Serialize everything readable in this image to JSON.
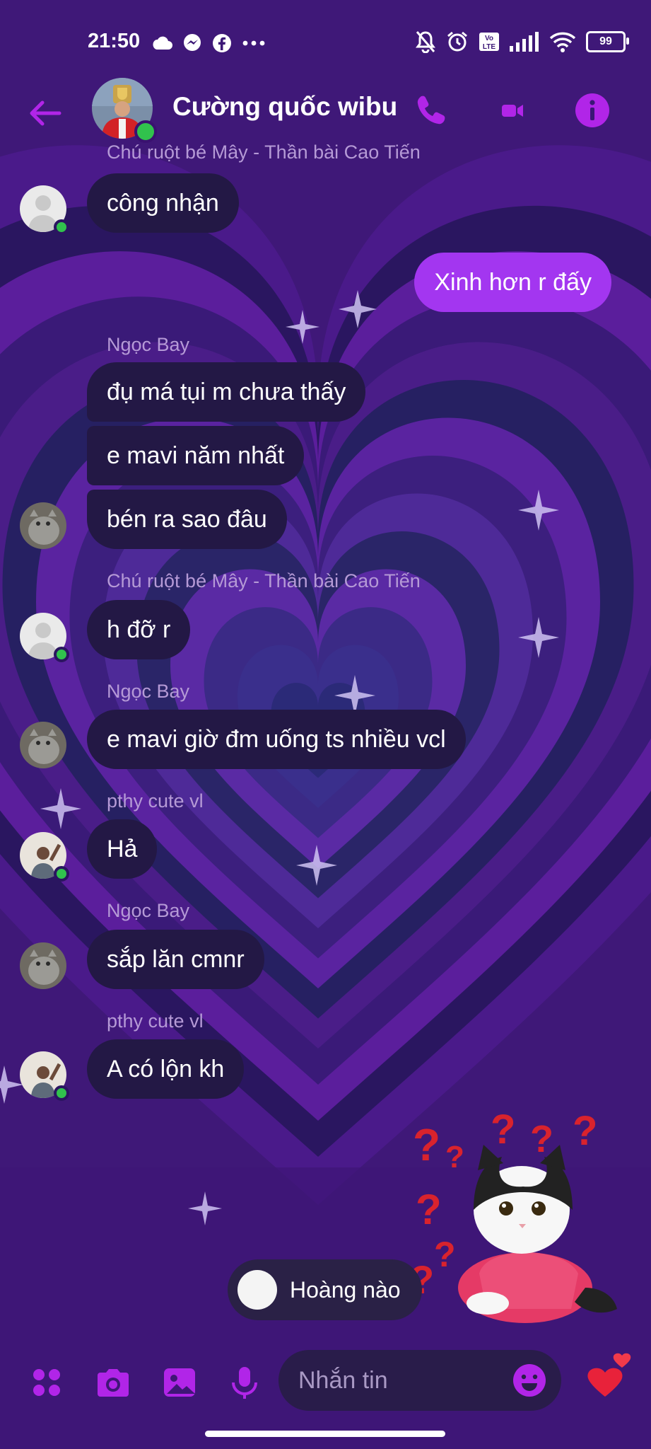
{
  "status_bar": {
    "time": "21:50",
    "battery": "99",
    "left_icons": [
      "cloud-icon",
      "messenger-icon",
      "facebook-icon",
      "more-dots-icon"
    ],
    "right_icons": [
      "mute-bell-icon",
      "alarm-icon",
      "volte-icon",
      "signal-icon",
      "wifi-icon",
      "battery-icon"
    ]
  },
  "header": {
    "title": "Cường quốc wibu",
    "icons": [
      "back-arrow-icon",
      "phone-icon",
      "video-call-icon",
      "info-icon"
    ]
  },
  "messages": [
    {
      "sender": "Chú ruột bé Mây - Thần bài Cao Tiến",
      "text": "công nhận",
      "direction": "in"
    },
    {
      "text": "Xinh hơn r đấy",
      "direction": "out"
    },
    {
      "sender": "Ngọc Bay",
      "text": "đụ má tụi m chưa thấy",
      "direction": "in"
    },
    {
      "text": "e mavi năm nhất",
      "direction": "in"
    },
    {
      "text": "bén ra sao đâu",
      "direction": "in"
    },
    {
      "sender": "Chú ruột bé Mây - Thần bài Cao Tiến",
      "text": "h đỡ r",
      "direction": "in"
    },
    {
      "sender": "Ngọc Bay",
      "text": "e mavi giờ đm uống ts nhiều vcl",
      "direction": "in"
    },
    {
      "sender": "pthy cute vl",
      "text": "Hả",
      "direction": "in"
    },
    {
      "sender": "Ngọc Bay",
      "text": "sắp lăn cmnr",
      "direction": "in"
    },
    {
      "sender": "pthy cute vl",
      "text": "A có lộn kh",
      "direction": "in"
    }
  ],
  "typing": {
    "label": "Hoàng nào"
  },
  "composer": {
    "placeholder": "Nhắn tin",
    "icons": [
      "apps-grid-icon",
      "camera-icon",
      "gallery-icon",
      "microphone-icon",
      "emoji-icon",
      "heart-like-icon"
    ]
  },
  "colors": {
    "accent": "#b125e8",
    "outgoing_bubble": "#a336f0",
    "incoming_bubble": "#231845",
    "online": "#31c24d",
    "background": "#3b1676"
  }
}
